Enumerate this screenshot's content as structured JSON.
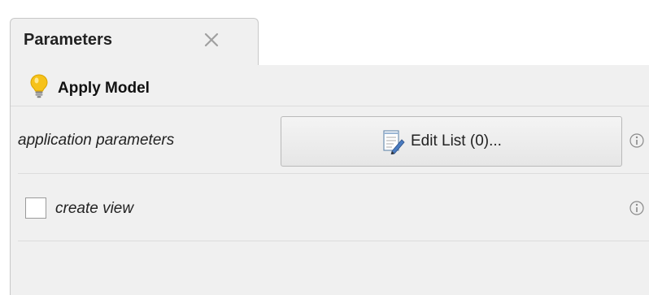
{
  "tab": {
    "title": "Parameters",
    "close_icon": "close-icon"
  },
  "toolbar": {
    "apply_label": "Apply Model",
    "apply_icon": "lightbulb-icon"
  },
  "parameters": [
    {
      "label": "application parameters",
      "button_label": "Edit List (0)...",
      "button_icon": "edit-list-icon",
      "info_icon": "info-icon"
    },
    {
      "label": "create view",
      "checked": false,
      "info_icon": "info-icon"
    }
  ],
  "colors": {
    "panel_background": "#f0f0f0",
    "bulb_yellow": "#f6c21a",
    "text": "#222222"
  }
}
